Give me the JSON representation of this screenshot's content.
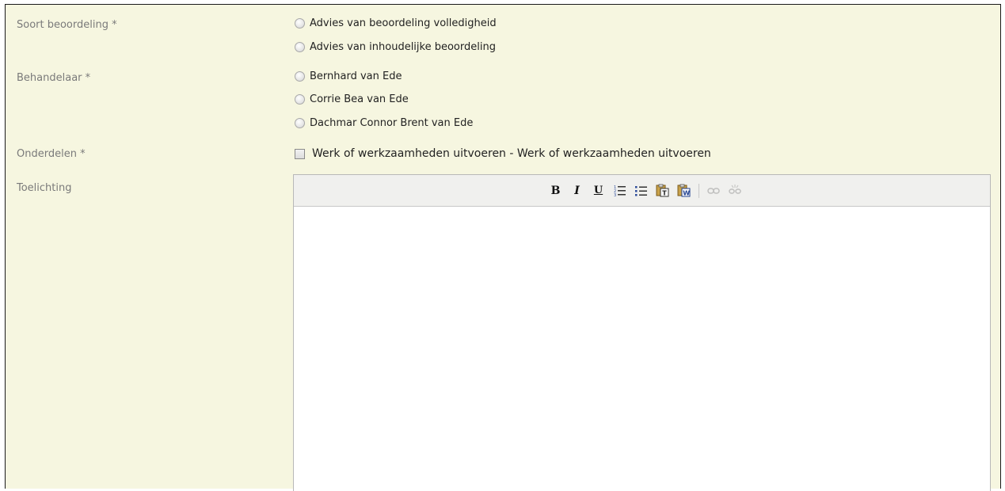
{
  "fields": {
    "soort": {
      "label": "Soort beoordeling *",
      "options": [
        "Advies van beoordeling volledigheid",
        "Advies van inhoudelijke beoordeling"
      ]
    },
    "behandelaar": {
      "label": "Behandelaar *",
      "options": [
        "Bernhard van Ede",
        "Corrie Bea van Ede",
        "Dachmar Connor Brent van Ede"
      ]
    },
    "onderdelen": {
      "label": "Onderdelen *",
      "option": "Werk of werkzaamheden uitvoeren - Werk of werkzaamheden uitvoeren",
      "checked": false
    },
    "toelichting": {
      "label": "Toelichting",
      "value": ""
    }
  },
  "toolbar": {
    "bold": "B",
    "italic": "I",
    "underline": "U"
  },
  "colors": {
    "form_background": "#f6f6e0",
    "label_text": "#7a7a7a",
    "toolbar_background": "#f0f0ee"
  }
}
